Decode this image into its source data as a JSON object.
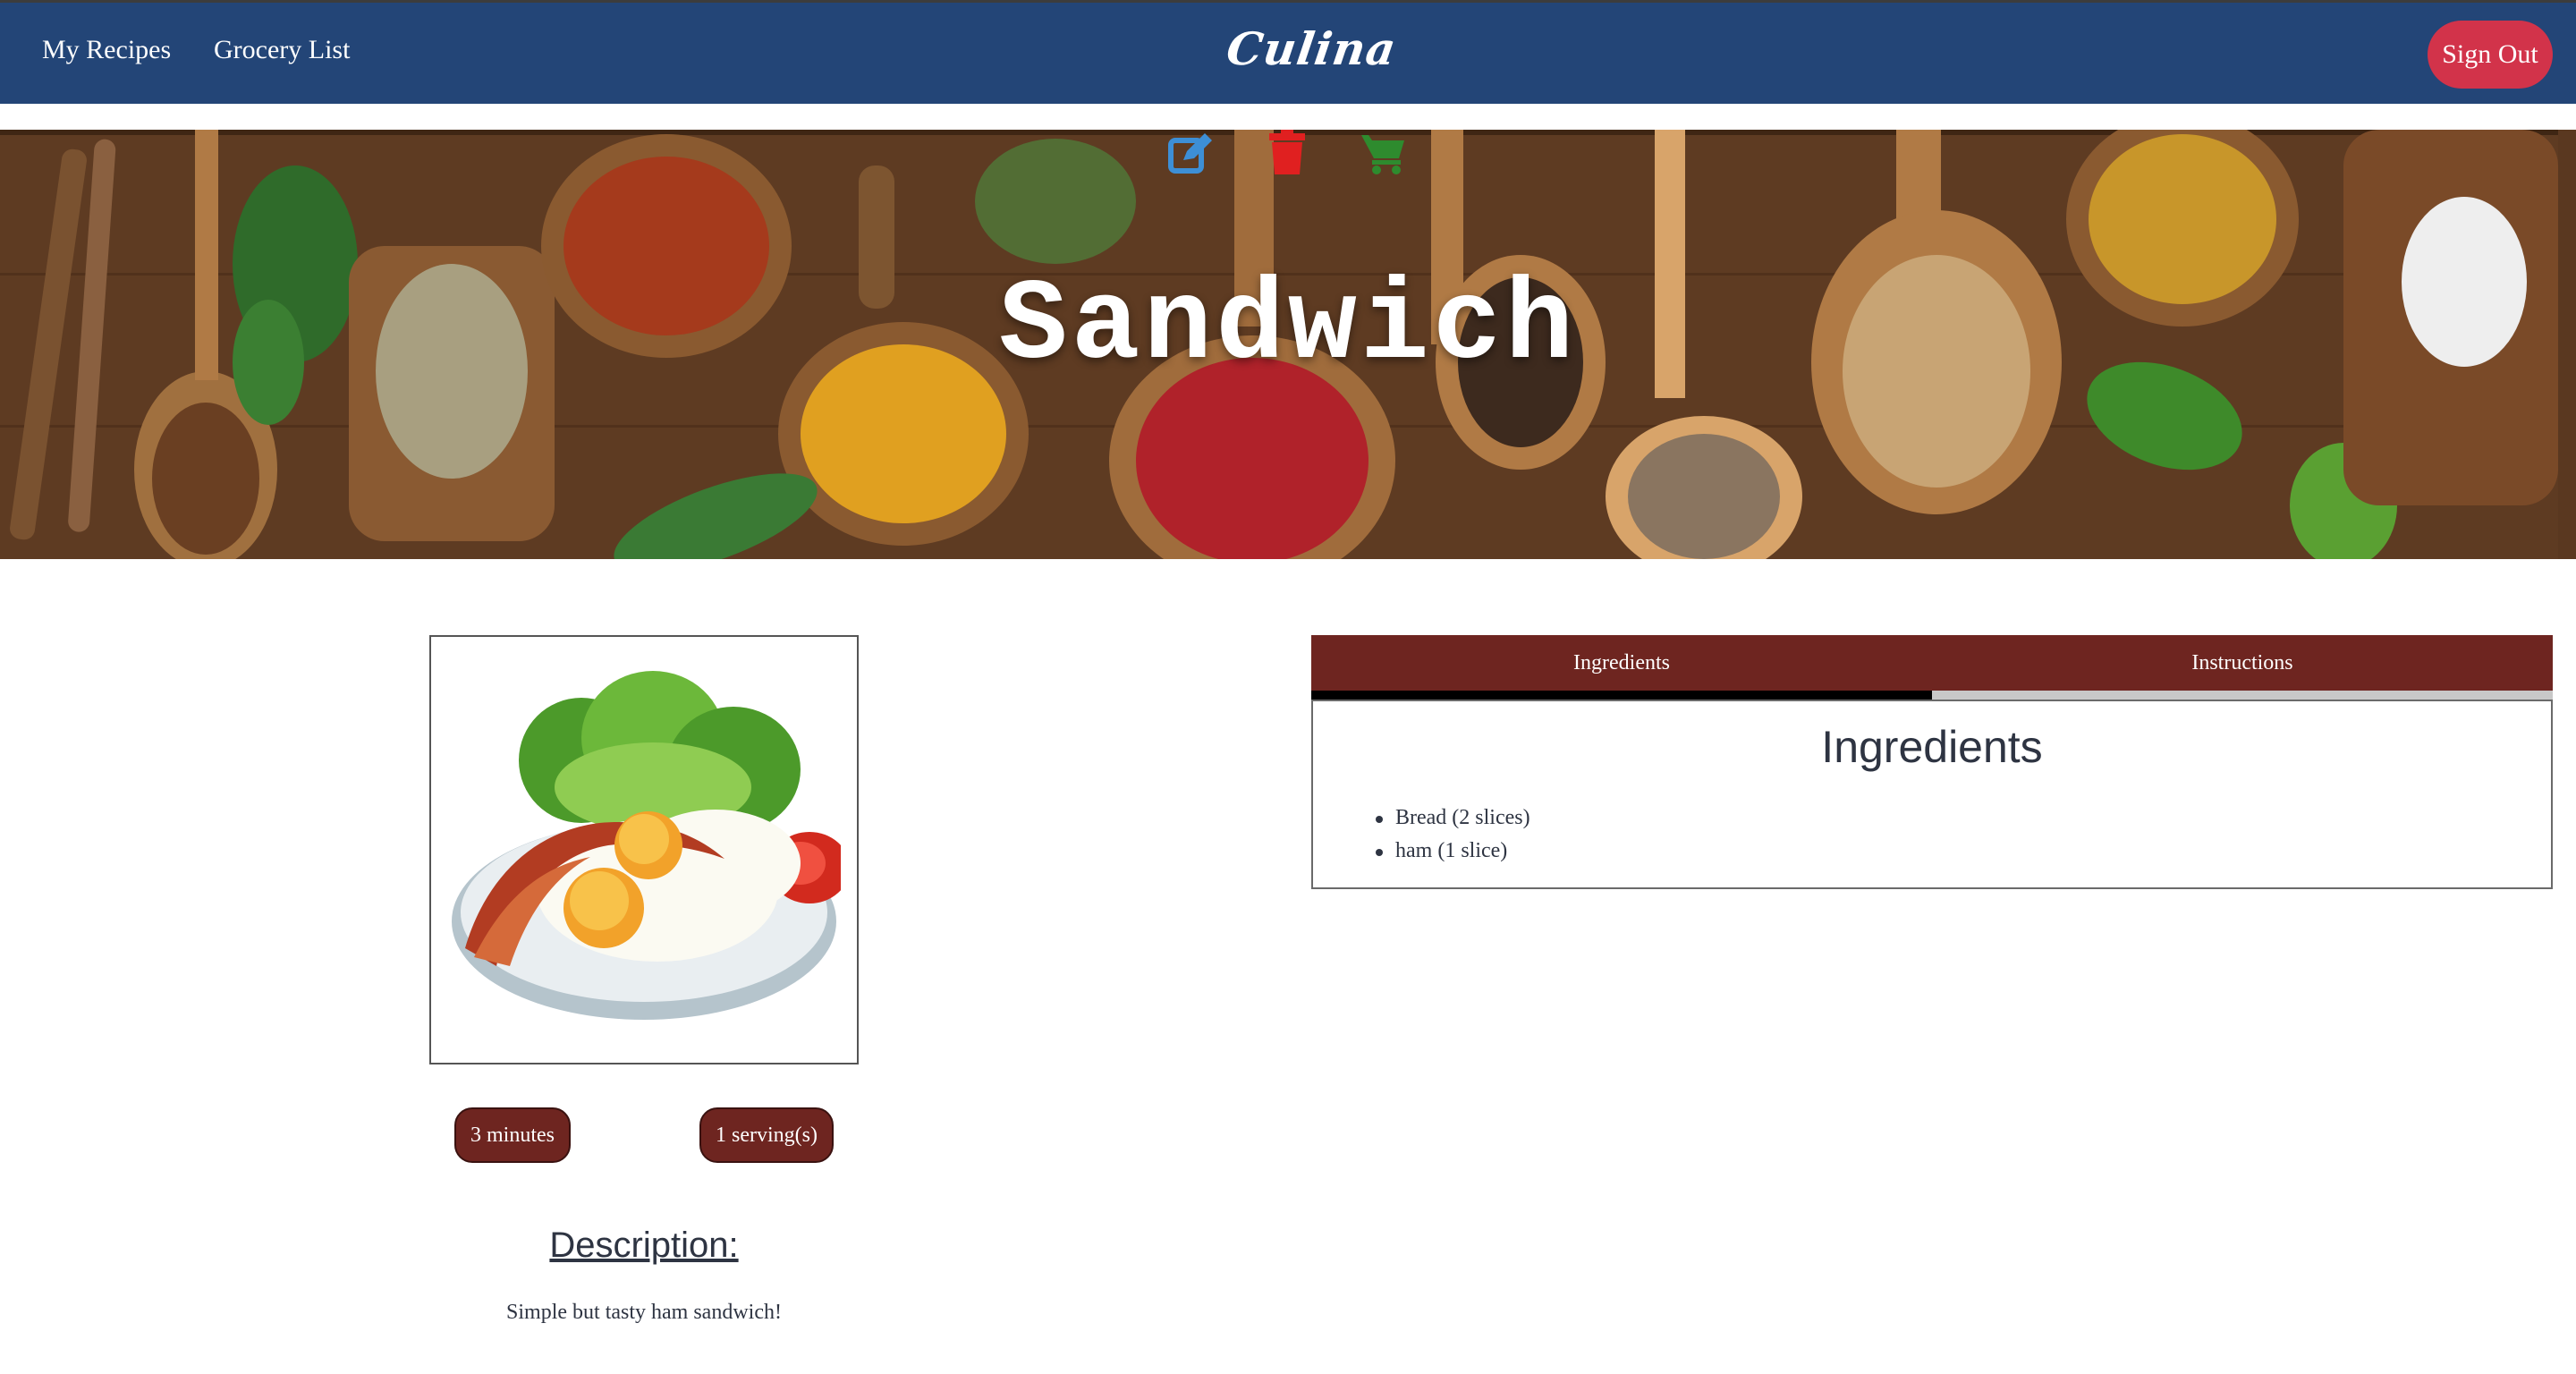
{
  "navbar": {
    "my_recipes": "My Recipes",
    "grocery_list": "Grocery List",
    "brand": "Culina",
    "sign_out": "Sign Out",
    "background_color": "#234577",
    "sign_out_color": "#d2334a"
  },
  "hero": {
    "title": "Sandwich",
    "icons": [
      {
        "name": "edit-icon",
        "color": "#3d8fd6"
      },
      {
        "name": "trash-icon",
        "color": "#e02020"
      },
      {
        "name": "cart-icon",
        "color": "#2e8b2e"
      }
    ]
  },
  "recipe": {
    "time": "3 minutes",
    "servings": "1 serving(s)",
    "description_heading": "Description:",
    "description": "Simple but tasty ham sandwich!"
  },
  "tabs": {
    "ingredients_label": "Ingredients",
    "instructions_label": "Instructions",
    "active": "ingredients",
    "tab_color": "#6e2520"
  },
  "ingredients": {
    "heading": "Ingredients",
    "items": [
      "Bread (2 slices)",
      "ham (1 slice)"
    ]
  }
}
